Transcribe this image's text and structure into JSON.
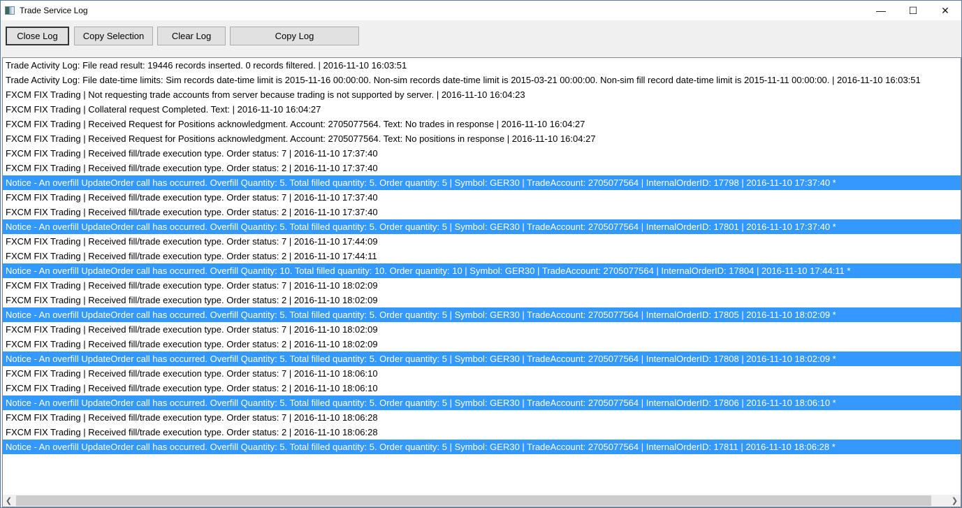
{
  "window": {
    "title": "Trade Service Log",
    "minimize": "—",
    "maximize": "☐",
    "close": "✕"
  },
  "toolbar": {
    "close_log": "Close Log",
    "copy_selection": "Copy Selection",
    "clear_log": "Clear Log",
    "copy_log": "Copy Log"
  },
  "scrollbar": {
    "left": "❮",
    "right": "❯"
  },
  "colors": {
    "selection": "#3399ff"
  },
  "log": [
    {
      "text": "Trade Activity Log: File read result: 19446 records inserted.  0 records filtered. | 2016-11-10  16:03:51",
      "selected": false
    },
    {
      "text": "Trade Activity Log: File date-time limits: Sim records date-time limit is 2015-11-16  00:00:00.  Non-sim records date-time limit is 2015-03-21  00:00:00.  Non-sim fill record date-time limit is 2015-11-11  00:00:00. | 2016-11-10  16:03:51",
      "selected": false
    },
    {
      "text": "FXCM FIX Trading | Not requesting trade accounts from server because trading is not supported by server. | 2016-11-10  16:04:23",
      "selected": false
    },
    {
      "text": "FXCM FIX Trading | Collateral request Completed. Text:  | 2016-11-10  16:04:27",
      "selected": false
    },
    {
      "text": "FXCM FIX Trading | Received Request for Positions acknowledgment. Account: 2705077564. Text: No trades in response | 2016-11-10  16:04:27",
      "selected": false
    },
    {
      "text": "FXCM FIX Trading | Received Request for Positions acknowledgment. Account: 2705077564. Text: No positions in response | 2016-11-10  16:04:27",
      "selected": false
    },
    {
      "text": "FXCM FIX Trading | Received fill/trade execution type. Order status: 7 | 2016-11-10  17:37:40",
      "selected": false
    },
    {
      "text": "FXCM FIX Trading | Received fill/trade execution type. Order status: 2 | 2016-11-10  17:37:40",
      "selected": false
    },
    {
      "text": "Notice - An overfill UpdateOrder call has occurred. Overfill Quantity: 5.  Total filled quantity: 5.  Order quantity: 5 | Symbol: GER30 | TradeAccount: 2705077564 | InternalOrderID: 17798 | 2016-11-10  17:37:40 *",
      "selected": true
    },
    {
      "text": "FXCM FIX Trading | Received fill/trade execution type. Order status: 7 | 2016-11-10  17:37:40",
      "selected": false
    },
    {
      "text": "FXCM FIX Trading | Received fill/trade execution type. Order status: 2 | 2016-11-10  17:37:40",
      "selected": false
    },
    {
      "text": "Notice - An overfill UpdateOrder call has occurred. Overfill Quantity: 5.  Total filled quantity: 5.  Order quantity: 5 | Symbol: GER30 | TradeAccount: 2705077564 | InternalOrderID: 17801 | 2016-11-10  17:37:40 *",
      "selected": true
    },
    {
      "text": "FXCM FIX Trading | Received fill/trade execution type. Order status: 7 | 2016-11-10  17:44:09",
      "selected": false
    },
    {
      "text": "FXCM FIX Trading | Received fill/trade execution type. Order status: 2 | 2016-11-10  17:44:11",
      "selected": false
    },
    {
      "text": "Notice - An overfill UpdateOrder call has occurred. Overfill Quantity: 10.  Total filled quantity: 10.  Order quantity: 10 | Symbol: GER30 | TradeAccount: 2705077564 | InternalOrderID: 17804 | 2016-11-10  17:44:11 *",
      "selected": true
    },
    {
      "text": "FXCM FIX Trading | Received fill/trade execution type. Order status: 7 | 2016-11-10  18:02:09",
      "selected": false
    },
    {
      "text": "FXCM FIX Trading | Received fill/trade execution type. Order status: 2 | 2016-11-10  18:02:09",
      "selected": false
    },
    {
      "text": "Notice - An overfill UpdateOrder call has occurred. Overfill Quantity: 5.  Total filled quantity: 5.  Order quantity: 5 | Symbol: GER30 | TradeAccount: 2705077564 | InternalOrderID: 17805 | 2016-11-10  18:02:09 *",
      "selected": true
    },
    {
      "text": "FXCM FIX Trading | Received fill/trade execution type. Order status: 7 | 2016-11-10  18:02:09",
      "selected": false
    },
    {
      "text": "FXCM FIX Trading | Received fill/trade execution type. Order status: 2 | 2016-11-10  18:02:09",
      "selected": false
    },
    {
      "text": "Notice - An overfill UpdateOrder call has occurred. Overfill Quantity: 5.  Total filled quantity: 5.  Order quantity: 5 | Symbol: GER30 | TradeAccount: 2705077564 | InternalOrderID: 17808 | 2016-11-10  18:02:09 *",
      "selected": true
    },
    {
      "text": "FXCM FIX Trading | Received fill/trade execution type. Order status: 7 | 2016-11-10  18:06:10",
      "selected": false
    },
    {
      "text": "FXCM FIX Trading | Received fill/trade execution type. Order status: 2 | 2016-11-10  18:06:10",
      "selected": false
    },
    {
      "text": "Notice - An overfill UpdateOrder call has occurred. Overfill Quantity: 5.  Total filled quantity: 5.  Order quantity: 5 | Symbol: GER30 | TradeAccount: 2705077564 | InternalOrderID: 17806 | 2016-11-10  18:06:10 *",
      "selected": true
    },
    {
      "text": "FXCM FIX Trading | Received fill/trade execution type. Order status: 7 | 2016-11-10  18:06:28",
      "selected": false
    },
    {
      "text": "FXCM FIX Trading | Received fill/trade execution type. Order status: 2 | 2016-11-10  18:06:28",
      "selected": false
    },
    {
      "text": "Notice - An overfill UpdateOrder call has occurred. Overfill Quantity: 5.  Total filled quantity: 5.  Order quantity: 5 | Symbol: GER30 | TradeAccount: 2705077564 | InternalOrderID: 17811 | 2016-11-10  18:06:28 *",
      "selected": true
    }
  ]
}
